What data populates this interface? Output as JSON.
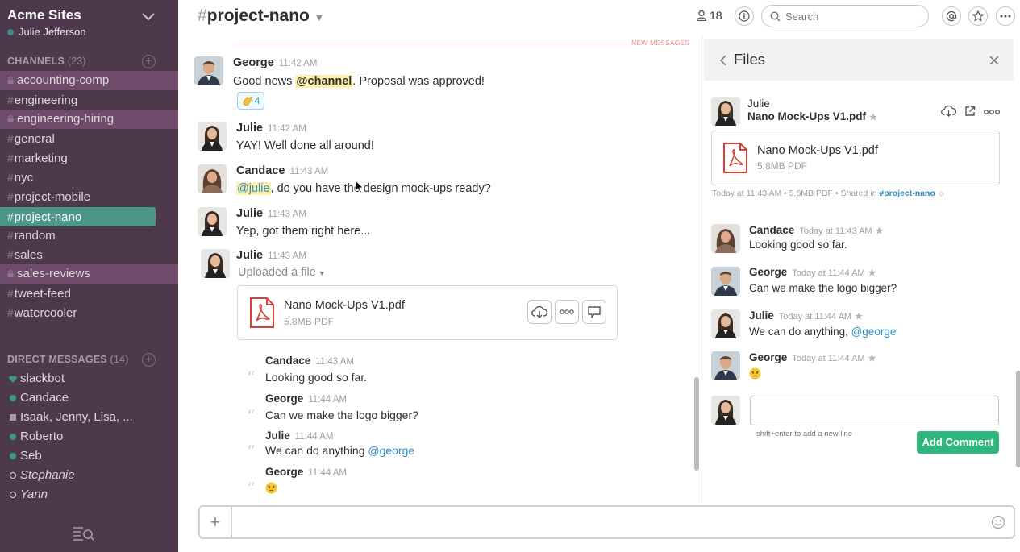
{
  "sidebar": {
    "team_name": "Acme Sites",
    "user_name": "Julie Jefferson",
    "channels_heading": "CHANNELS",
    "channels_count": "(23)",
    "channels": [
      {
        "name": "accounting-comp"
      },
      {
        "name": "engineering"
      },
      {
        "name": "engineering-hiring"
      },
      {
        "name": "general"
      },
      {
        "name": "marketing"
      },
      {
        "name": "nyc"
      },
      {
        "name": "project-mobile"
      },
      {
        "name": "project-nano"
      },
      {
        "name": "random"
      },
      {
        "name": "sales"
      },
      {
        "name": "sales-reviews"
      },
      {
        "name": "tweet-feed"
      },
      {
        "name": "watercooler"
      }
    ],
    "dm_heading": "DIRECT MESSAGES",
    "dm_count": "(14)",
    "dms": [
      {
        "name": "slackbot"
      },
      {
        "name": "Candace"
      },
      {
        "name": "Isaak, Jenny, Lisa, ..."
      },
      {
        "name": "Roberto"
      },
      {
        "name": "Seb"
      },
      {
        "name": "Stephanie"
      },
      {
        "name": "Yann"
      }
    ],
    "colors": {
      "background": "#4d394b",
      "selected": "#4c9689",
      "highlight": "#6e4a6b"
    }
  },
  "header": {
    "channel_hash": "#",
    "channel_name": "project-nano",
    "member_count": "18",
    "search_placeholder": "Search"
  },
  "messages": {
    "new_messages_label": "NEW MESSAGES",
    "items": [
      {
        "author": "George",
        "time": "11:42 AM",
        "text_before": "Good news ",
        "mention": "@channel",
        "text_after": ". Proposal was approved!",
        "reaction_count": "4"
      },
      {
        "author": "Julie",
        "time": "11:42 AM",
        "text": "YAY! Well done all around!"
      },
      {
        "author": "Candace",
        "time": "11:43 AM",
        "mention": "@julie",
        "text_after": ", do you have the design mock-ups ready?"
      },
      {
        "author": "Julie",
        "time": "11:43 AM",
        "text": "Yep, got them right here..."
      },
      {
        "author": "Julie",
        "time": "11:43 AM",
        "text": "Uploaded a file"
      }
    ],
    "file": {
      "name": "Nano Mock-Ups V1.pdf",
      "meta": "5.8MB PDF"
    },
    "thread": [
      {
        "author": "Candace",
        "time": "11:43 AM",
        "text": "Looking good so far."
      },
      {
        "author": "George",
        "time": "11:44 AM",
        "text": "Can we make the logo bigger?"
      },
      {
        "author": "Julie",
        "time": "11:44 AM",
        "text_before": "We can do anything ",
        "mention": "@george"
      },
      {
        "author": "George",
        "time": "11:44 AM",
        "emoji": "angry-face"
      }
    ]
  },
  "files_panel": {
    "title": "Files",
    "uploader": "Julie",
    "file_name": "Nano Mock-Ups V1.pdf",
    "file_meta": "5.8MB PDF",
    "meta_line": "Today at 11:43 AM • 5.8MB PDF • Shared in",
    "shared_in": "#project-nano",
    "comments": [
      {
        "author": "Candace",
        "time": "Today at 11:43 AM",
        "text": "Looking good so far."
      },
      {
        "author": "George",
        "time": "Today at 11:44 AM",
        "text": "Can we make the logo bigger?"
      },
      {
        "author": "Julie",
        "time": "Today at 11:44 AM",
        "text_before": "We can do anything, ",
        "mention": "@george"
      },
      {
        "author": "George",
        "time": "Today at 11:44 AM",
        "emoji": "angry-face"
      }
    ],
    "comment_hint": "shift+enter to add a new line",
    "add_comment_label": "Add Comment",
    "accent_color": "#2fb67c"
  }
}
